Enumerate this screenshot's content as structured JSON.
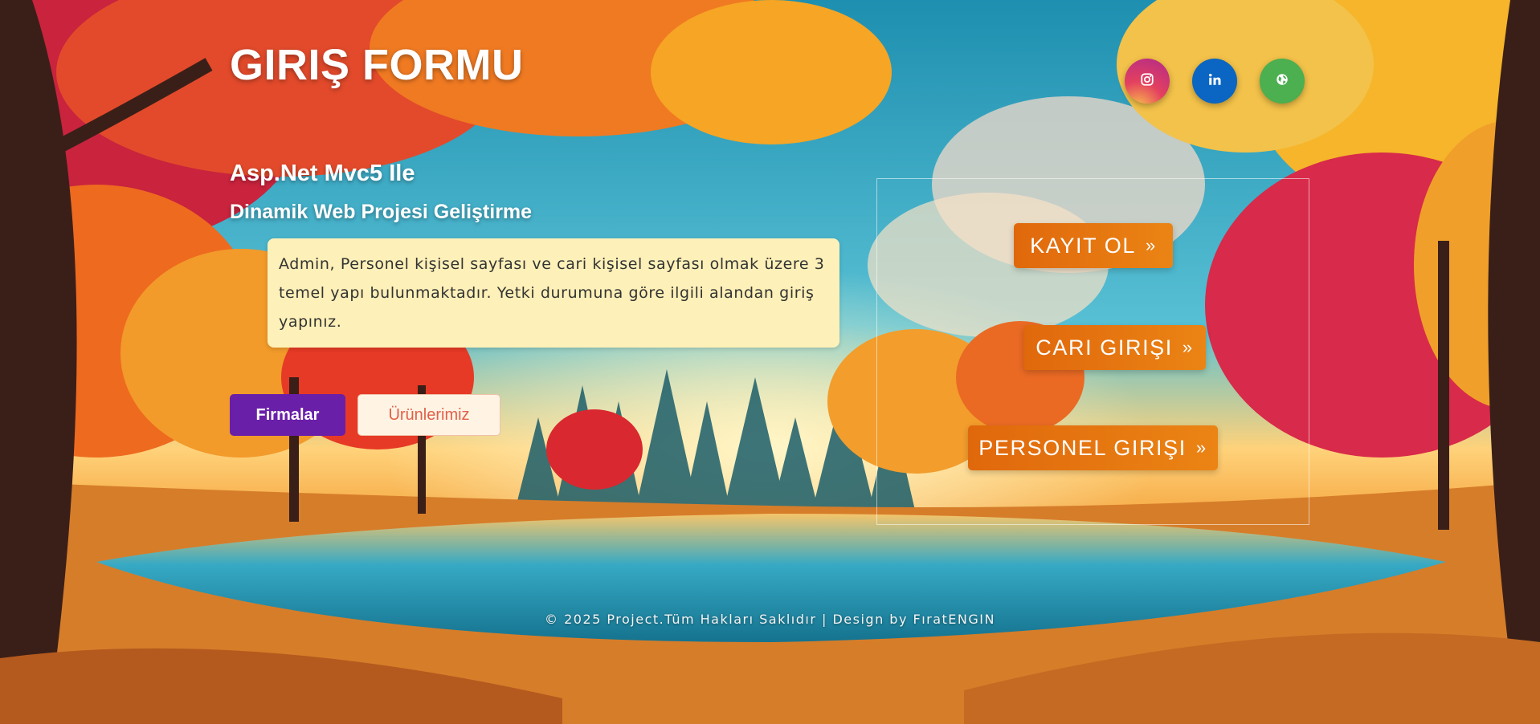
{
  "header": {
    "title": "GIRIŞ FORMU"
  },
  "social": [
    {
      "name": "instagram",
      "icon": "instagram-icon",
      "color": "#e4405f"
    },
    {
      "name": "linkedin",
      "icon": "linkedin-icon",
      "color": "#0a66c2"
    },
    {
      "name": "website",
      "icon": "globe-icon",
      "color": "#4caf50"
    }
  ],
  "hero": {
    "subtitle": "Asp.Net Mvc5 Ile",
    "subtitle2": "Dinamik Web Projesi Geliştirme",
    "description": "Admin, Personel kişisel sayfası ve cari kişisel sayfası olmak üzere 3 temel yapı bulunmaktadır. Yetki durumuna göre ilgili alandan giriş yapınız."
  },
  "buttons": {
    "firmalar": "Firmalar",
    "urunler": "Ürünlerimiz"
  },
  "login_links": {
    "kayit": "KAYIT OL",
    "cari": "CARI GIRIŞI",
    "personel": "PERSONEL GIRIŞI",
    "arrow": "»"
  },
  "footer": {
    "text": "© 2025 Project.Tüm Hakları Saklıdır | Design by FıratENGIN"
  },
  "colors": {
    "accent_orange": "#e0680c",
    "primary_purple": "#6a1fa8",
    "info_box": "#fdf0b8"
  }
}
